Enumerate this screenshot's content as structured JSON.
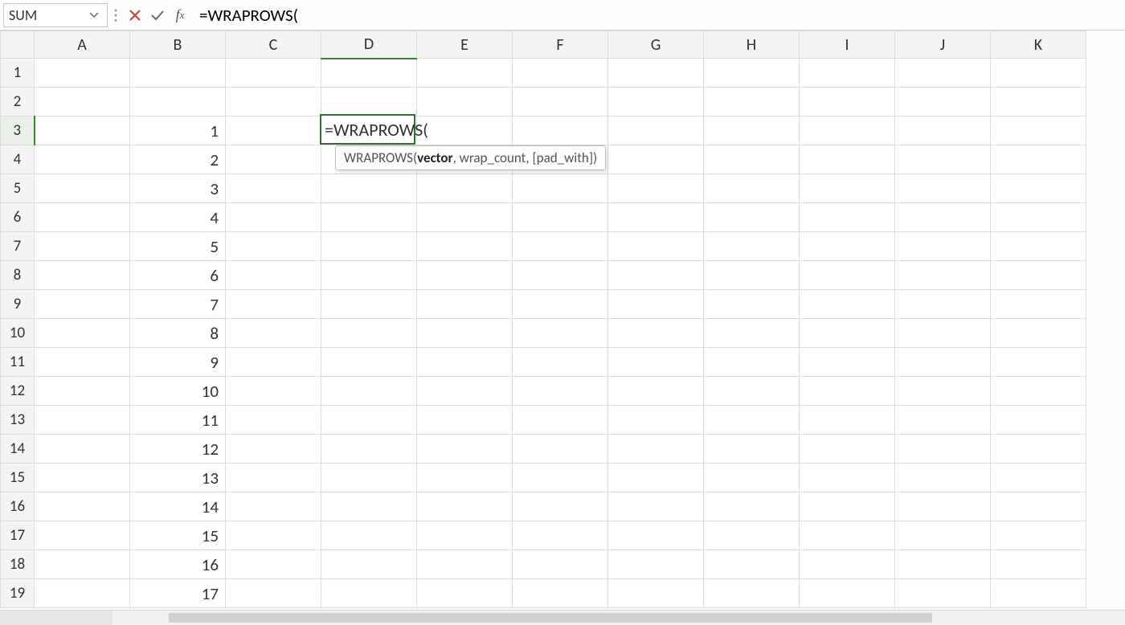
{
  "name_box": "SUM",
  "formula": "=WRAPROWS(",
  "tooltip": {
    "fn": "WRAPROWS",
    "arg_current": "vector",
    "arg_rest": ", wrap_count, [pad_with])"
  },
  "columns": [
    "A",
    "B",
    "C",
    "D",
    "E",
    "F",
    "G",
    "H",
    "I",
    "J",
    "K"
  ],
  "rows": [
    1,
    2,
    3,
    4,
    5,
    6,
    7,
    8,
    9,
    10,
    11,
    12,
    13,
    14,
    15,
    16,
    17,
    18,
    19
  ],
  "col_b_values": {
    "3": "1",
    "4": "2",
    "5": "3",
    "6": "4",
    "7": "5",
    "8": "6",
    "9": "7",
    "10": "8",
    "11": "9",
    "12": "10",
    "13": "11",
    "14": "12",
    "15": "13",
    "16": "14",
    "17": "15",
    "18": "16",
    "19": "17"
  },
  "active_cell": {
    "col": "D",
    "row": 3,
    "display": "=WRAPROWS("
  }
}
